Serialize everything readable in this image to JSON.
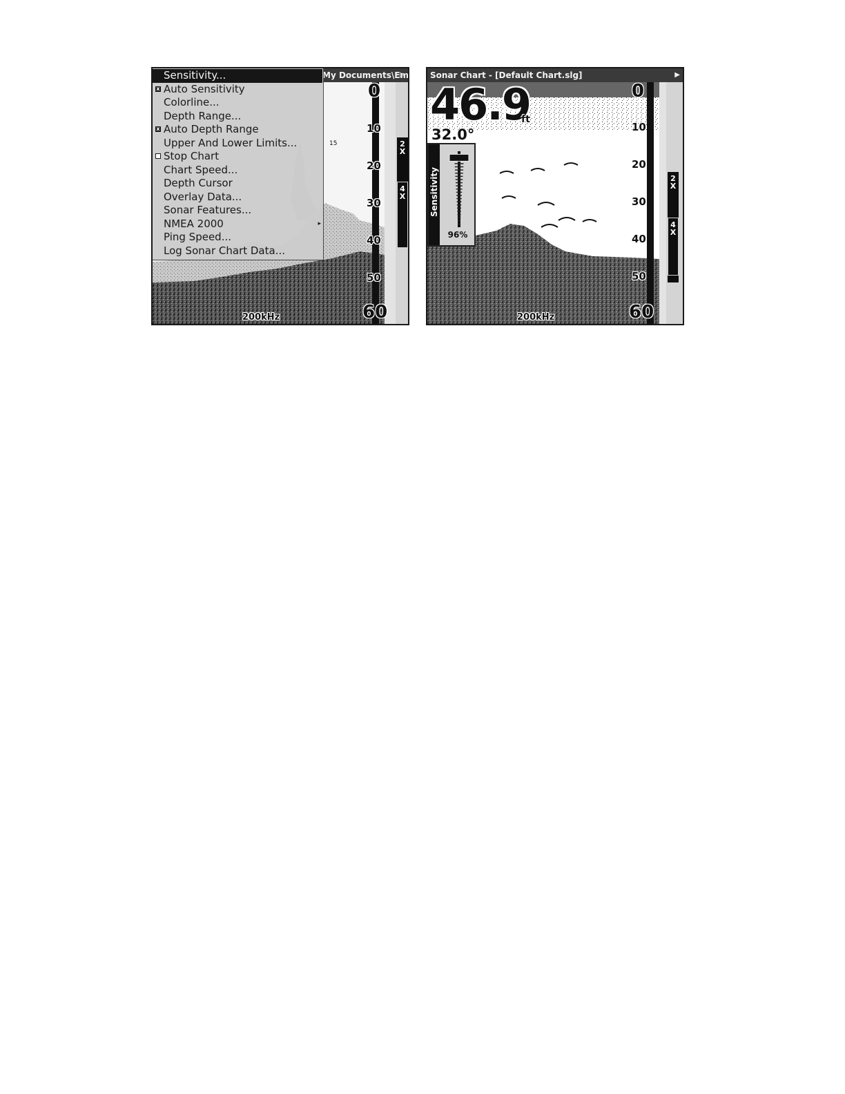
{
  "left_screen": {
    "title": "My Documents\\Emula...",
    "title_arrow": "▷",
    "menu": {
      "items": [
        {
          "label": "Sensitivity...",
          "checkbox": null,
          "selected": true
        },
        {
          "label": "Auto Sensitivity",
          "checkbox": "checked"
        },
        {
          "label": "Colorline...",
          "checkbox": null
        },
        {
          "label": "Depth Range...",
          "checkbox": null
        },
        {
          "label": "Auto Depth Range",
          "checkbox": "checked"
        },
        {
          "label": "Upper And Lower Limits...",
          "checkbox": null
        },
        {
          "label": "Stop Chart",
          "checkbox": "unchecked"
        },
        {
          "label": "Chart Speed...",
          "checkbox": null
        },
        {
          "label": "Depth Cursor",
          "checkbox": null
        },
        {
          "label": "Overlay Data...",
          "checkbox": null
        },
        {
          "label": "Sonar Features...",
          "checkbox": null
        },
        {
          "label": "NMEA 2000",
          "checkbox": null,
          "submenu": true
        },
        {
          "label": "Ping Speed...",
          "checkbox": null
        },
        {
          "label": "Log Sonar Chart Data...",
          "checkbox": null
        }
      ],
      "submenu_arrow": "▸"
    },
    "depth_scale": [
      "0",
      "10",
      "20",
      "30",
      "40",
      "50",
      "60"
    ],
    "frequency": "200kHz",
    "zoom": {
      "z2": "2\nX",
      "z4": "4\nX"
    },
    "fish_depth": "15"
  },
  "right_screen": {
    "title": "Sonar Chart - [Default Chart.slg]",
    "title_arrow": "▶",
    "depth_value": "46.9",
    "depth_unit": "ft",
    "temperature": "32.0°",
    "sensitivity_label": "Sensitivity",
    "sensitivity_percent": "96%",
    "sensitivity_level": 0.96,
    "depth_scale": [
      "0",
      "10",
      "20",
      "30",
      "40",
      "50",
      "60"
    ],
    "frequency": "200kHz",
    "zoom": {
      "z2": "2\nX",
      "z4": "4\nX"
    }
  },
  "colors": {
    "title_bar": "#3a3a3a",
    "menu_bg": "#cdcdcd",
    "selection": "#151515"
  }
}
